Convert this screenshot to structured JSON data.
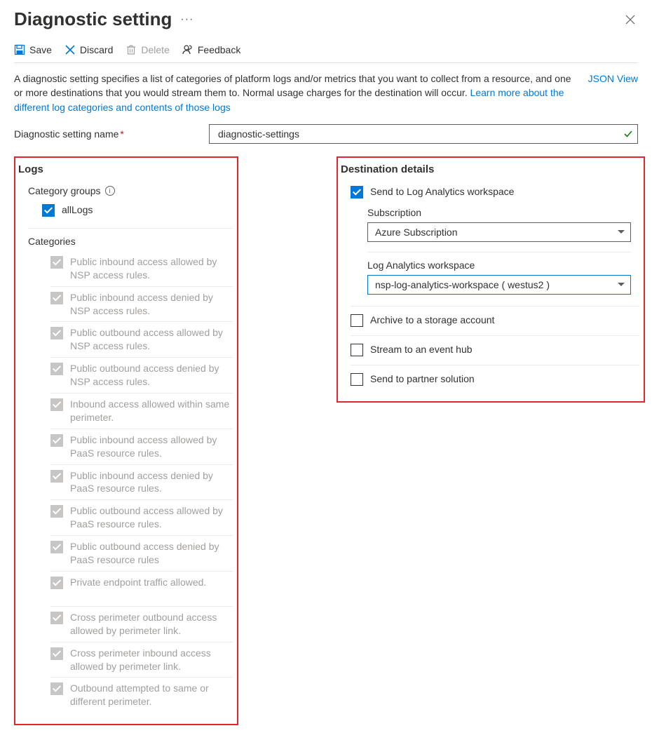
{
  "header": {
    "title": "Diagnostic setting",
    "ellipsis": "···",
    "close": "✕"
  },
  "toolbar": {
    "save": "Save",
    "discard": "Discard",
    "delete": "Delete",
    "feedback": "Feedback"
  },
  "description": {
    "text": "A diagnostic setting specifies a list of categories of platform logs and/or metrics that you want to collect from a resource, and one or more destinations that you would stream them to. Normal usage charges for the destination will occur. ",
    "learn_more": "Learn more about the different log categories and contents of those logs",
    "json_view": "JSON View"
  },
  "name_row": {
    "label": "Diagnostic setting name",
    "required_marker": "*",
    "value": "diagnostic-settings"
  },
  "logs": {
    "header": "Logs",
    "category_groups_label": "Category groups",
    "all_logs_label": "allLogs",
    "categories_label": "Categories",
    "items": [
      "Public inbound access allowed by NSP access rules.",
      "Public inbound access denied by NSP access rules.",
      "Public outbound access allowed by NSP access rules.",
      "Public outbound access denied by NSP access rules.",
      "Inbound access allowed within same perimeter.",
      "Public inbound access allowed by PaaS resource rules.",
      "Public inbound access denied by PaaS resource rules.",
      "Public outbound access allowed by PaaS resource rules.",
      "Public outbound access denied by PaaS resource rules",
      "Private endpoint traffic allowed.",
      "Cross perimeter outbound access allowed by perimeter link.",
      "Cross perimeter inbound access allowed by perimeter link.",
      "Outbound attempted to same or different perimeter."
    ]
  },
  "destination": {
    "header": "Destination details",
    "log_analytics_label": "Send to Log Analytics workspace",
    "subscription_label": "Subscription",
    "subscription_value": "Azure Subscription",
    "workspace_label": "Log Analytics workspace",
    "workspace_value": "nsp-log-analytics-workspace ( westus2 )",
    "storage_label": "Archive to a storage account",
    "eventhub_label": "Stream to an event hub",
    "partner_label": "Send to partner solution"
  }
}
